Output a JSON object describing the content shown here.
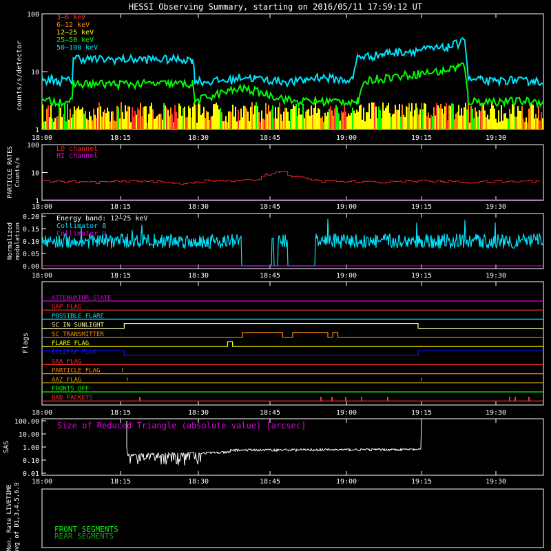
{
  "title": "HESSI Observing Summary, starting on 2016/05/11 17:59:12 UT",
  "time_ticks": [
    "18:00",
    "18:15",
    "18:30",
    "18:45",
    "19:00",
    "19:15",
    "19:30"
  ],
  "colors": {
    "c3_6": "#ff3030",
    "c6_12": "#ff8c00",
    "c12_25": "#ffff00",
    "c25_50": "#00ff00",
    "c50_100": "#00e5ff",
    "particle": "#ff2020",
    "magenta": "#e000e0",
    "white": "#ffffff",
    "frame": "#ffffff"
  },
  "chart_data": [
    {
      "type": "line",
      "name": "count-rates",
      "ylabel": "counts/s/detector",
      "yscale": "log",
      "ylim": [
        1,
        100
      ],
      "yticks": [
        "1",
        "10",
        "100"
      ],
      "xlim": [
        0,
        100
      ],
      "legend": [
        "3–6 keV",
        "6–12 keV",
        "12–25 keV",
        "25–50 keV",
        "50–100 keV"
      ],
      "legend_placement": "top-left",
      "series": [
        {
          "name": "50–100 keV",
          "x": [
            0,
            2,
            4,
            6,
            8,
            10,
            12,
            12.5,
            14,
            20,
            30,
            40,
            50,
            58,
            60,
            61,
            65,
            75,
            80,
            85,
            90,
            100,
            105,
            110,
            120,
            124,
            126,
            130,
            132,
            134,
            136,
            137,
            138,
            140,
            145,
            150,
            155,
            160,
            162,
            164,
            166,
            168,
            170,
            175,
            180,
            185,
            190,
            192,
            194,
            196,
            198,
            200
          ],
          "y": [
            7,
            6.5,
            7.5,
            6.5,
            7,
            6.8,
            7,
            17,
            17,
            16,
            16,
            16,
            16,
            16,
            16,
            7,
            6.5,
            7,
            8,
            7.5,
            7,
            6.5,
            7,
            8,
            7,
            7,
            18,
            18,
            18.5,
            19,
            19.5,
            20,
            21,
            21,
            22,
            23,
            24,
            25,
            26,
            28,
            30,
            40,
            7,
            7,
            6.5,
            7,
            7,
            6.5,
            6.8,
            7,
            6.5,
            7
          ]
        },
        {
          "name": "25–50 keV",
          "x": [
            0,
            12,
            12.5,
            60,
            61,
            70,
            80,
            90,
            100,
            110,
            120,
            126,
            130,
            140,
            150,
            160,
            166,
            168,
            170,
            200
          ],
          "y": [
            3,
            3,
            6,
            6,
            3,
            4,
            5,
            4,
            3,
            3,
            3,
            3,
            7,
            8,
            9,
            10,
            12,
            13,
            3,
            3
          ]
        },
        {
          "name": "12–25 keV",
          "x": [
            0,
            200
          ],
          "y": [
            1.5,
            1.5
          ]
        },
        {
          "name": "6–12 keV",
          "x": [
            0,
            200
          ],
          "y": [
            2.2,
            2.2
          ]
        },
        {
          "name": "3–6 keV",
          "x": [
            0,
            200
          ],
          "y": [
            1.3,
            1.3
          ]
        }
      ]
    },
    {
      "type": "line",
      "name": "particle-rates",
      "ylabel": "PARTICLE RATES Counts/s",
      "yscale": "log",
      "ylim": [
        1,
        100
      ],
      "yticks": [
        "1",
        "10",
        "100"
      ],
      "legend": [
        "LO channel",
        "HI channel"
      ],
      "series": [
        {
          "name": "LO channel",
          "x": [
            0,
            20,
            40,
            55,
            65,
            80,
            86,
            90,
            95,
            100,
            110,
            130,
            150,
            170,
            200
          ],
          "y": [
            5,
            4.5,
            5,
            4,
            5,
            5,
            6,
            9,
            11,
            7,
            5,
            4.5,
            5,
            4.5,
            5
          ]
        },
        {
          "name": "HI channel",
          "x": [
            0,
            200
          ],
          "y": [
            1,
            1
          ]
        }
      ]
    },
    {
      "type": "line",
      "name": "modulation",
      "ylabel": "Normalized modulation",
      "ylim": [
        0,
        0.2
      ],
      "yticks": [
        "0.00",
        "0.05",
        "0.10",
        "0.15",
        "0.20"
      ],
      "legend": [
        "Energy band: 12–25 keV",
        "Collimator 8",
        "Collimator 9"
      ],
      "series": [
        {
          "name": "Collimator 8",
          "x": [
            0,
            200
          ],
          "y": [
            0.1,
            0.1
          ]
        },
        {
          "name": "Collimator 9",
          "x": [
            0,
            200
          ],
          "y": [
            0.0,
            0.0
          ]
        }
      ]
    },
    {
      "type": "line",
      "name": "flags",
      "ylabel": "Flags",
      "flags": [
        {
          "label": "ATTENUATOR STATE",
          "color": "#e000e0",
          "segments": [
            [
              0,
              1,
              0
            ]
          ]
        },
        {
          "label": "GAP FLAG",
          "color": "#ff3030",
          "segments": [
            [
              0,
              1,
              0
            ]
          ]
        },
        {
          "label": "POSSIBLE FLARE",
          "color": "#00e5ff",
          "segments": [
            [
              0,
              1,
              0
            ]
          ]
        },
        {
          "label": "SC IN SUNLIGHT",
          "color": "#ffffaa",
          "segments": [
            [
              0,
              0.164,
              0
            ],
            [
              0.164,
              0.75,
              1
            ],
            [
              0.75,
              1,
              0
            ]
          ]
        },
        {
          "label": "SC TRANSMITTER",
          "color": "#ff8c00",
          "segments": [
            [
              0,
              0.4,
              0
            ],
            [
              0.4,
              0.48,
              1
            ],
            [
              0.48,
              0.5,
              0
            ],
            [
              0.5,
              0.57,
              1
            ],
            [
              0.57,
              0.58,
              0
            ],
            [
              0.58,
              0.59,
              1
            ],
            [
              0.59,
              1,
              0
            ]
          ]
        },
        {
          "label": "FLARE FLAG",
          "color": "#ffff00",
          "segments": [
            [
              0,
              0.37,
              0
            ],
            [
              0.37,
              0.38,
              1
            ],
            [
              0.38,
              1,
              0
            ]
          ]
        },
        {
          "label": "ECLIPSE FLAG",
          "color": "#1010ff",
          "segments": [
            [
              0,
              0.164,
              1
            ],
            [
              0.164,
              0.75,
              0
            ],
            [
              0.75,
              1,
              1
            ]
          ]
        },
        {
          "label": "SAA FLAG",
          "color": "#ff3030",
          "segments": [
            [
              0,
              1,
              0
            ]
          ]
        },
        {
          "label": "PARTICLE FLAG",
          "color": "#ff8c00",
          "segments": [
            [
              0,
              1,
              0
            ]
          ]
        },
        {
          "label": "AAZ FLAG",
          "color": "#c8a000",
          "segments": [
            [
              0,
              1,
              0
            ]
          ]
        },
        {
          "label": "FRONTS OFF",
          "color": "#00ff00",
          "segments": [
            [
              0,
              1,
              0
            ]
          ]
        },
        {
          "label": "BAD PACKETS",
          "color": "#ff3030",
          "segments": [
            [
              0,
              1,
              0
            ]
          ]
        }
      ]
    },
    {
      "type": "line",
      "name": "sas",
      "ylabel": "SAS",
      "yscale": "log",
      "ylim": [
        0.01,
        100
      ],
      "yticks": [
        "0.01",
        "0.10",
        "1.00",
        "10.00",
        "100.00"
      ],
      "annotation": "Size of Reduced Triangle (absolute value) [arcsec]"
    },
    {
      "type": "line",
      "name": "livetime",
      "ylabel": "Mon. Rate LIVETIME avg of D1,3,4,5,6,9",
      "legend": [
        "FRONT SEGMENTS",
        "REAR SEGMENTS"
      ]
    }
  ]
}
